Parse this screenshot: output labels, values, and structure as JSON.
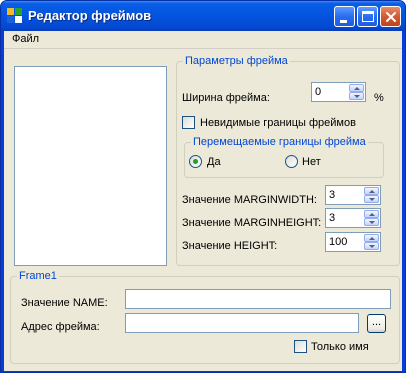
{
  "window": {
    "title": "Редактор фреймов",
    "title_color": "#ffffff",
    "accent": "#0046d5",
    "titlebar_buttons": [
      {
        "icon": "minimize-icon"
      },
      {
        "icon": "maximize-icon"
      },
      {
        "icon": "close-icon"
      }
    ]
  },
  "menu": {
    "items": [
      "Файл"
    ]
  },
  "frame_params": {
    "legend": "Параметры фрейма",
    "width_label": "Ширина фрейма:",
    "width_value": "0",
    "width_unit": "%",
    "invisible_borders_label": "Невидимые границы фреймов",
    "invisible_borders_checked": false,
    "movable": {
      "legend": "Перемещаемые границы фрейма",
      "options": [
        "Да",
        "Нет"
      ],
      "selected": "Да"
    },
    "marginwidth_label": "Значение MARGINWIDTH:",
    "marginwidth_value": "3",
    "marginheight_label": "Значение MARGINHEIGHT:",
    "marginheight_value": "3",
    "height_label": "Значение HEIGHT:",
    "height_value": "100"
  },
  "frame1": {
    "legend": "Frame1",
    "name_label": "Значение NAME:",
    "name_value": "",
    "address_label": "Адрес фрейма:",
    "address_value": "",
    "browse_label": "...",
    "name_only_label": "Только имя",
    "name_only_checked": false
  }
}
